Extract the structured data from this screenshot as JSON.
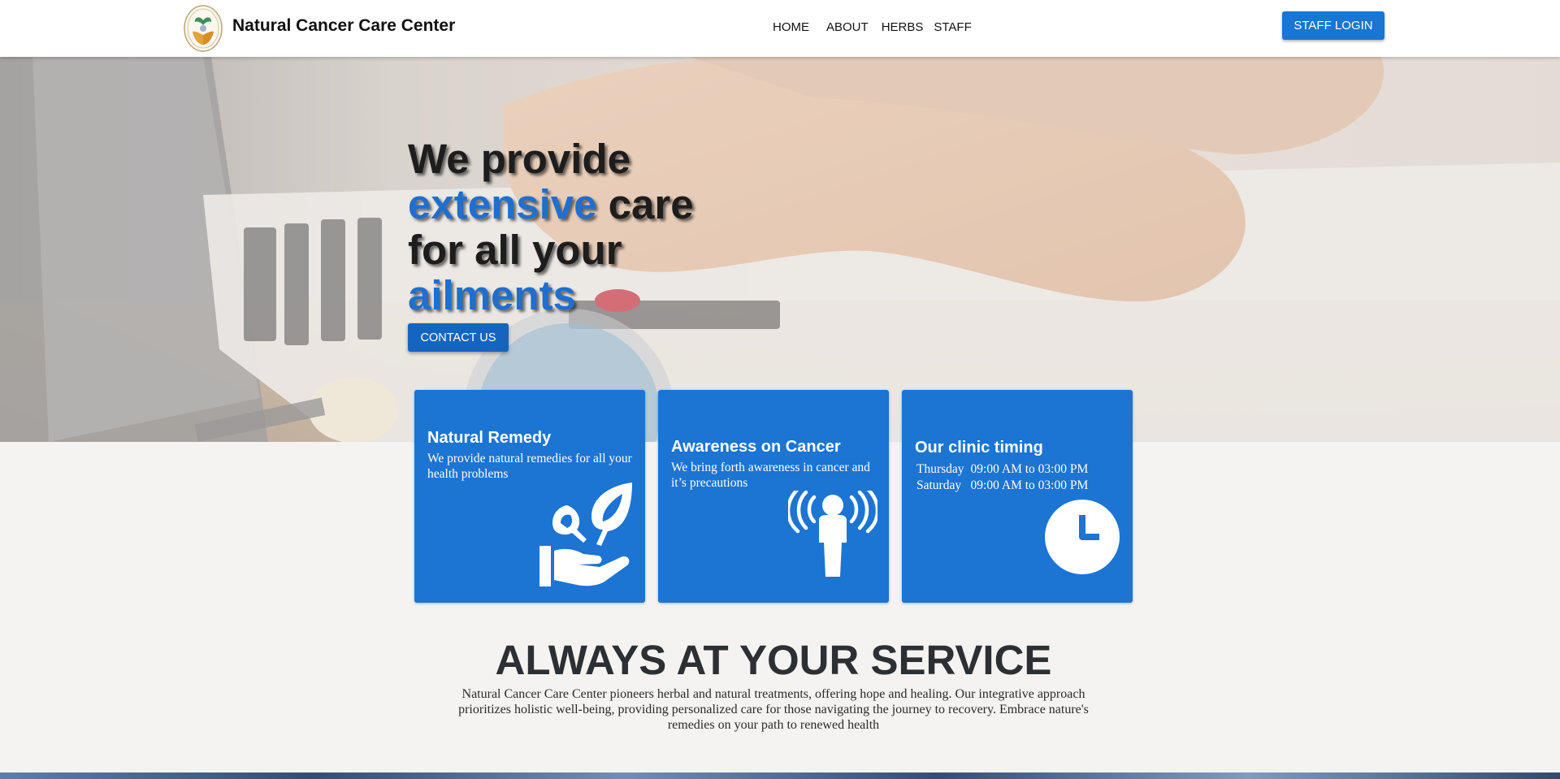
{
  "header": {
    "site_title": "Natural Cancer Care Center",
    "logo_text": "NATURAL CANCER CARE CENTER",
    "nav": [
      "HOME",
      "ABOUT",
      "HERBS",
      "STAFF"
    ],
    "staff_login_label": "STAFF LOGIN"
  },
  "hero": {
    "line1": "We provide",
    "line2_blue": "extensive",
    "line2_rest": " care",
    "line3": "for all your",
    "line4_blue": "ailments",
    "contact_label": "CONTACT US"
  },
  "cards": [
    {
      "title": "Natural Remedy",
      "text": "We provide natural remedies for all your health problems",
      "icon": "hand-plant-icon"
    },
    {
      "title": "Awareness on Cancer",
      "text": "We bring forth awareness in cancer and it’s precautions",
      "icon": "person-broadcast-icon"
    },
    {
      "title": "Our clinic timing",
      "icon": "clock-icon",
      "timings": [
        {
          "day": "Thursday",
          "hours": "09:00 AM to 03:00 PM"
        },
        {
          "day": "Saturday",
          "hours": "09:00 AM to 03:00 PM"
        }
      ]
    }
  ],
  "service": {
    "title": "ALWAYS AT YOUR SERVICE",
    "text": "Natural Cancer Care Center pioneers herbal and natural treatments, offering hope and healing. Our integrative approach prioritizes holistic well-being, providing personalized care for those navigating the journey to recovery. Embrace nature's remedies on your path to renewed health"
  },
  "colors": {
    "accent": "#1c74d3",
    "button": "#1565c0",
    "header_bg": "#ffffff",
    "page_bg": "#f4f3f1"
  }
}
